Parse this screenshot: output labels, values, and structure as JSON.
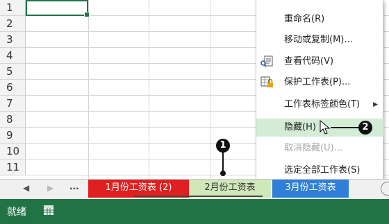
{
  "rows": [
    "1",
    "2",
    "3",
    "4",
    "5",
    "6",
    "7",
    "8",
    "9",
    "10",
    "11"
  ],
  "menu": {
    "items": [
      {
        "label": "重命名(R)",
        "icon": "",
        "state": "normal"
      },
      {
        "label": "移动或复制(M)...",
        "icon": "",
        "state": "normal"
      },
      {
        "label": "查看代码(V)",
        "icon": "view-code-icon",
        "state": "normal"
      },
      {
        "label": "保护工作表(P)...",
        "icon": "protect-sheet-icon",
        "state": "normal"
      },
      {
        "label": "工作表标签颜色(T)",
        "icon": "",
        "state": "submenu",
        "arrow": "▶"
      },
      {
        "label": "隐藏(H)",
        "icon": "",
        "state": "highlighted"
      },
      {
        "label": "取消隐藏(U)...",
        "icon": "",
        "state": "disabled"
      },
      {
        "label": "选定全部工作表(S)",
        "icon": "",
        "state": "normal"
      }
    ]
  },
  "callouts": {
    "one": "1",
    "two": "2"
  },
  "tabs": {
    "nav_prev": "◀",
    "nav_next": "▶",
    "ellipsis": "...",
    "items": [
      {
        "label": "1月份工资表 (2)",
        "color": "#e02020"
      },
      {
        "label": "2月份工资表",
        "color": "#cfe7b9"
      },
      {
        "label": "3月份工资表",
        "color": "#2f7fd8"
      }
    ]
  },
  "status": {
    "text": "就绪",
    "icon": "macro-record-icon"
  },
  "colors": {
    "accent": "#217346",
    "highlight": "#d4ecd6"
  }
}
